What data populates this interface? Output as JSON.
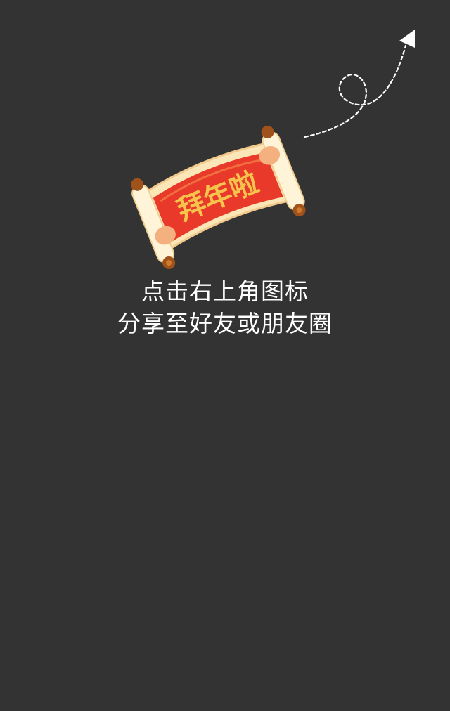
{
  "share_overlay": {
    "scroll_banner_text": "拜年啦",
    "instruction_line_1": "点击右上角图标",
    "instruction_line_2": "分享至好友或朋友圈",
    "icons": {
      "arrow": "dashed-curved-arrow-icon",
      "scroll": "new-year-scroll-icon"
    },
    "colors": {
      "background": "#333333",
      "text": "#ffffff",
      "banner_red": "#e8392b",
      "banner_gold": "#f6c44c",
      "scroll_cream": "#fbe6b8",
      "knob_brown": "#a0521b"
    }
  }
}
